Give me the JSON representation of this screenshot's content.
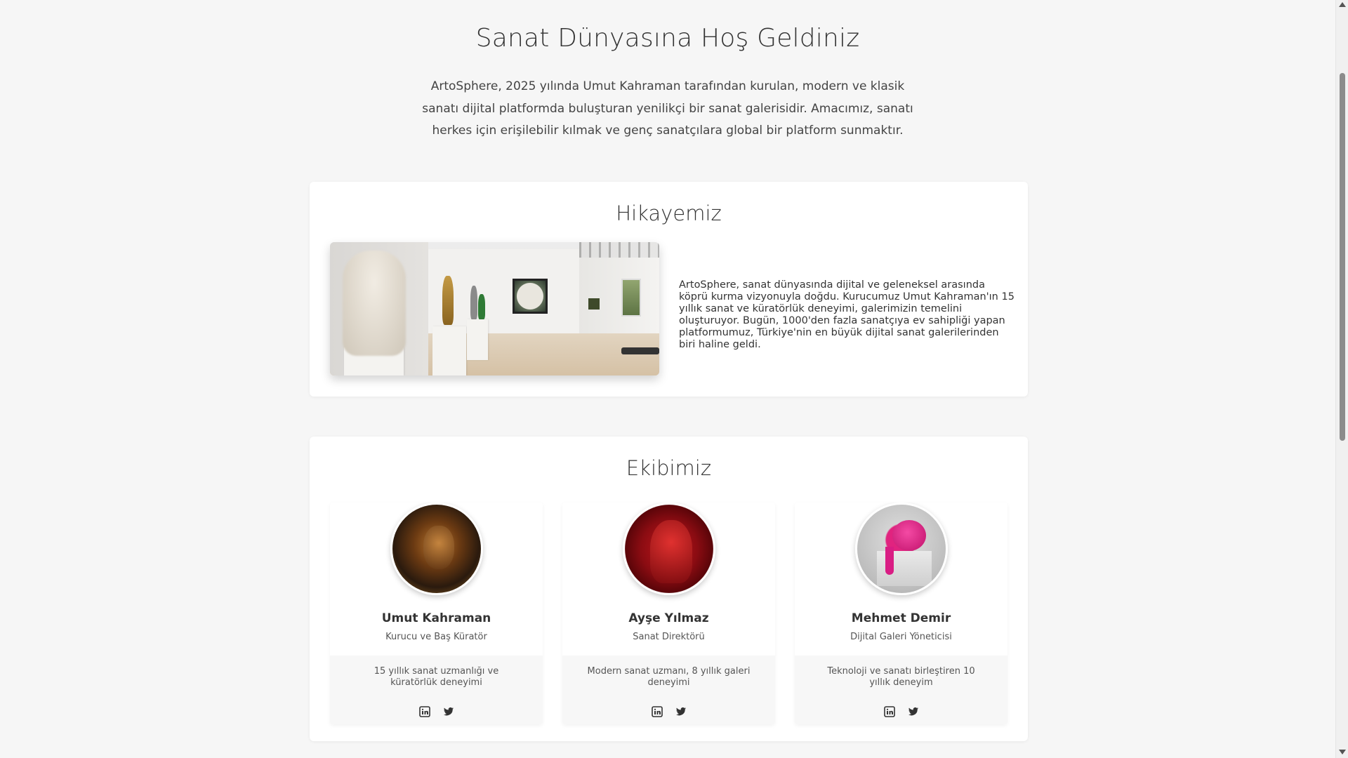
{
  "hero": {
    "title": "Sanat Dünyasına Hoş Geldiniz",
    "intro": "ArtoSphere, 2025 yılında Umut Kahraman tarafından kurulan, modern ve klasik sanatı dijital platformda buluşturan yenilikçi bir sanat galerisidir. Amacımız, sanatı herkes için erişilebilir kılmak ve genç sanatçılara global bir platform sunmaktır."
  },
  "story": {
    "title": "Hikayemiz",
    "text": "ArtoSphere, sanat dünyasında dijital ve geleneksel arasında köprü kurma vizyonuyla doğdu. Kurucumuz Umut Kahraman'ın 15 yıllık sanat ve küratörlük deneyimi, galerimizin temelini oluşturuyor. Bugün, 1000'den fazla sanatçıya ev sahipliği yapan platformumuz, Türkiye'nin en büyük dijital sanat galerilerinden biri haline geldi."
  },
  "team": {
    "title": "Ekibimiz",
    "members": [
      {
        "name": "Umut Kahraman",
        "role": "Kurucu ve Baş Küratör",
        "desc": "15 yıllık sanat uzmanlığı ve küratörlük deneyimi",
        "socials": [
          "linkedin-icon",
          "twitter-icon"
        ]
      },
      {
        "name": "Ayşe Yılmaz",
        "role": "Sanat Direktörü",
        "desc": "Modern sanat uzmanı, 8 yıllık galeri deneyimi",
        "socials": [
          "linkedin-icon",
          "twitter-icon"
        ]
      },
      {
        "name": "Mehmet Demir",
        "role": "Dijital Galeri Yöneticisi",
        "desc": "Teknoloji ve sanatı birleştiren 10 yıllık deneyim",
        "socials": [
          "linkedin-icon",
          "twitter-icon"
        ]
      }
    ]
  },
  "colors": {
    "background": "#f6f6f6",
    "card": "#ffffff",
    "text": "#333333"
  }
}
